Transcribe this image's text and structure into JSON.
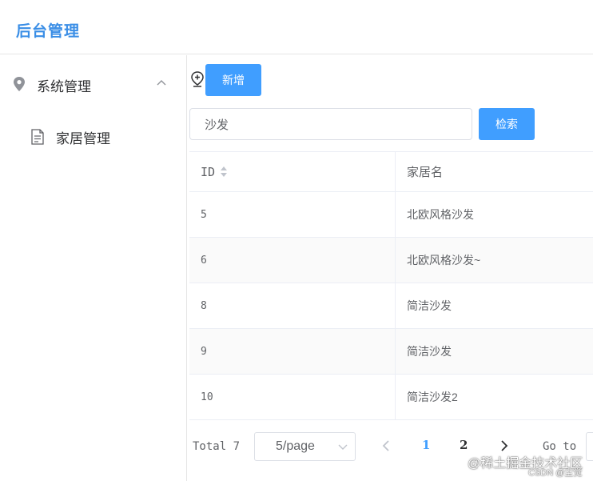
{
  "header": {
    "title": "后台管理"
  },
  "sidebar": {
    "group": {
      "label": "系统管理",
      "icon": "location-pin-icon",
      "expanded": true
    },
    "items": [
      {
        "label": "家居管理",
        "icon": "document-icon"
      }
    ]
  },
  "toolbar": {
    "add_label": "新增"
  },
  "search": {
    "value": "沙发",
    "button_label": "检索"
  },
  "table": {
    "columns": [
      "ID",
      "家居名"
    ],
    "rows": [
      {
        "id": "5",
        "name": "北欧风格沙发"
      },
      {
        "id": "6",
        "name": "北欧风格沙发~"
      },
      {
        "id": "8",
        "name": "简洁沙发"
      },
      {
        "id": "9",
        "name": "简洁沙发"
      },
      {
        "id": "10",
        "name": "简洁沙发2"
      }
    ]
  },
  "pagination": {
    "total_label": "Total 7",
    "page_size": "5/page",
    "pages": [
      "1",
      "2"
    ],
    "current_page": "1",
    "goto_label": "Go to"
  },
  "watermark": {
    "line1": "@稀土掘金技术社区",
    "line2": "CSDN @尘觉"
  },
  "colors": {
    "accent": "#409eff",
    "title": "#3a8ee6",
    "border": "#ebeef5"
  }
}
